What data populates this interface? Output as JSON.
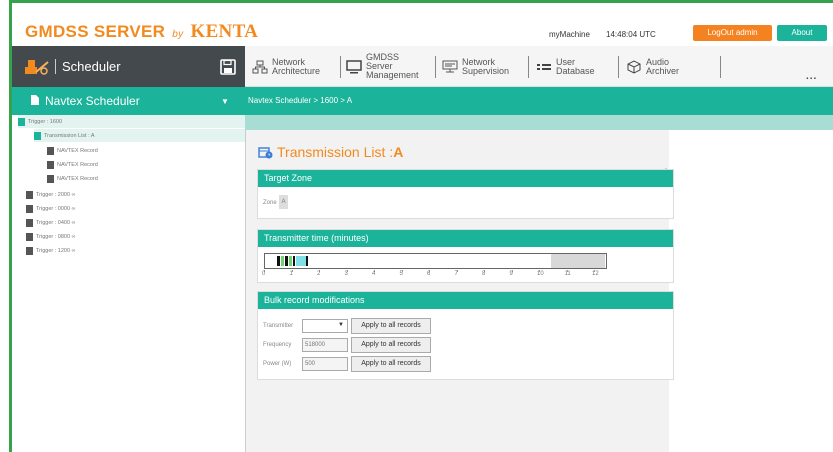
{
  "header": {
    "logo_main": "GMDSS SERVER",
    "logo_by": "by",
    "logo_brand": "KENTA",
    "machine": "myMachine",
    "time": "14:48:04 UTC",
    "logout_label": "LogOut admin",
    "about_label": "About"
  },
  "nav": {
    "scheduler_label": "Scheduler",
    "items": [
      {
        "label": "Network\nArchitecture",
        "icon": "network-architecture-icon"
      },
      {
        "label": "GMDSS\nServer\nManagement",
        "icon": "monitor-icon"
      },
      {
        "label": "Network\nSupervision",
        "icon": "network-supervision-icon"
      },
      {
        "label": "User\nDatabase",
        "icon": "user-database-icon"
      },
      {
        "label": "Audio\nArchiver",
        "icon": "cube-icon"
      }
    ],
    "more_label": "..."
  },
  "sidebar": {
    "title": "Navtex Scheduler",
    "tree": [
      {
        "label": "Trigger : 1600"
      },
      {
        "label": "Transmission List : A"
      },
      {
        "label": "NAVTEX Record"
      },
      {
        "label": "NAVTEX Record"
      },
      {
        "label": "NAVTEX Record"
      },
      {
        "label": "Trigger : 2000 ∞"
      },
      {
        "label": "Trigger : 0000 ∞"
      },
      {
        "label": "Trigger : 0400 ∞"
      },
      {
        "label": "Trigger : 0800 ∞"
      },
      {
        "label": "Trigger : 1200 ∞"
      }
    ]
  },
  "breadcrumb": "Navtex Scheduler > 1600 > A",
  "main": {
    "title_prefix": "Transmission List : ",
    "title_zone": "A",
    "target_zone": {
      "heading": "Target Zone",
      "zone_label": "Zone",
      "zone_value": "A"
    },
    "transmitter_time": {
      "heading": "Transmitter time (minutes)",
      "ticks": [
        "0",
        "1",
        "2",
        "3",
        "4",
        "5",
        "6",
        "7",
        "8",
        "9",
        "10",
        "11",
        "12"
      ]
    },
    "bulk": {
      "heading": "Bulk record modifications",
      "transmitter_label": "Transmitter",
      "transmitter_value": "",
      "frequency_label": "Frequency",
      "frequency_value": "518000",
      "power_label": "Power (W)",
      "power_value": "500",
      "apply_label": "Apply to all records"
    }
  },
  "colors": {
    "accent": "#1cb39b",
    "brand": "#f28a1f",
    "logout": "#f58220"
  }
}
